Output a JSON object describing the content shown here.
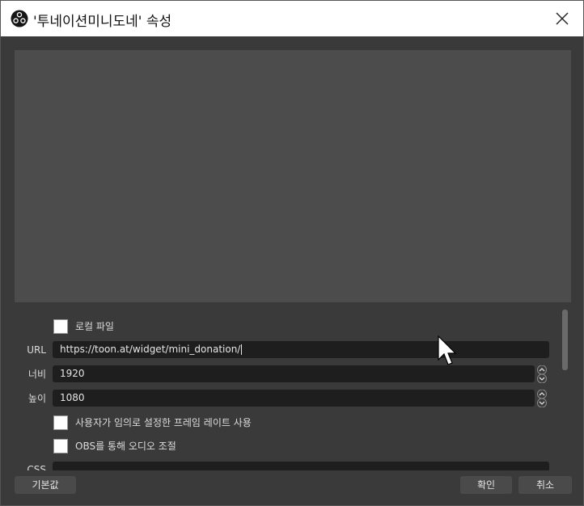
{
  "window": {
    "title": "'투네이션미니도네' 속성"
  },
  "icons": {
    "app": "obs-logo-icon",
    "close": "close-icon"
  },
  "properties": {
    "local_file_label": "로컬 파일",
    "url_label": "URL",
    "url_value": "https://toon.at/widget/mini_donation/",
    "width_label": "너비",
    "width_value": "1920",
    "height_label": "높이",
    "height_value": "1080",
    "custom_fps_label": "사용자가 임의로 설정한 프레임 레이트 사용",
    "obs_audio_label": "OBS를 통해 오디오 조절",
    "css_label": "CSS"
  },
  "buttons": {
    "defaults": "기본값",
    "ok": "확인",
    "cancel": "취소"
  },
  "colors": {
    "window_bg": "#3a3a3a",
    "preview_bg": "#4c4c4c",
    "field_bg": "#1e1e1e",
    "button_bg": "#4a4a4a"
  }
}
